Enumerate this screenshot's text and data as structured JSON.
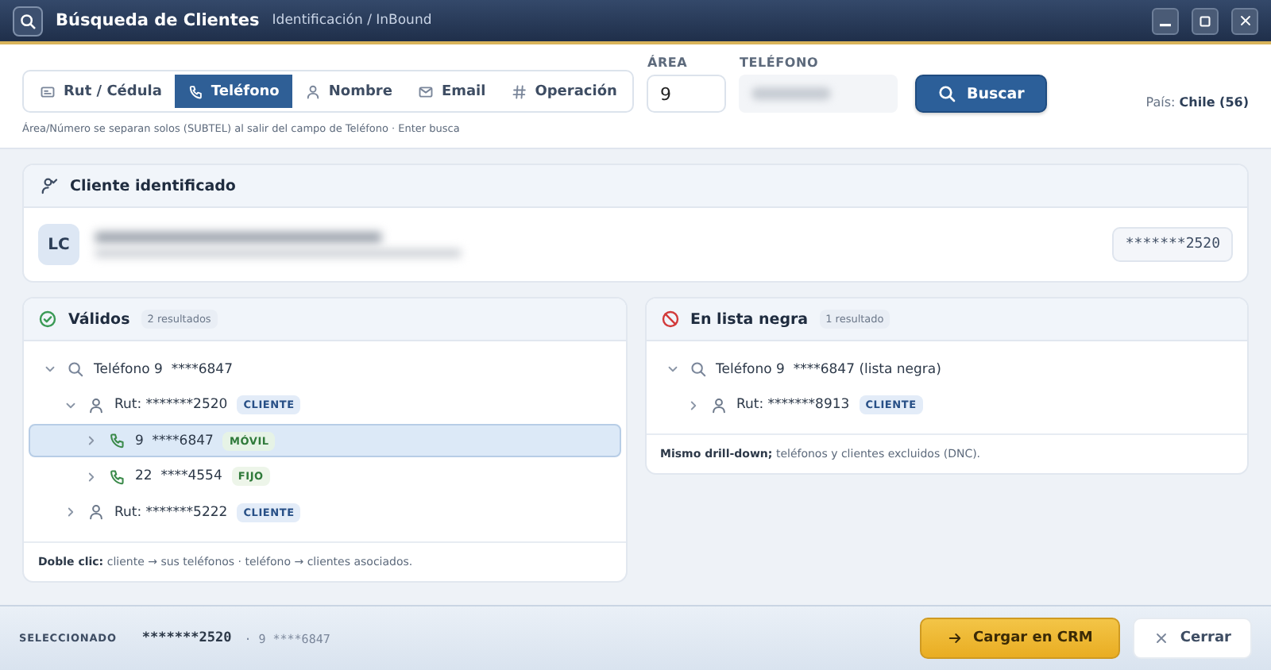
{
  "window": {
    "title": "Búsqueda de Clientes",
    "subtitle": "Identificación / InBound"
  },
  "search": {
    "tabs": [
      {
        "label": "Rut / Cédula",
        "kind": "id",
        "selected": false
      },
      {
        "label": "Teléfono",
        "kind": "phone",
        "selected": true
      },
      {
        "label": "Nombre",
        "kind": "person",
        "selected": false
      },
      {
        "label": "Email",
        "kind": "mail",
        "selected": false
      },
      {
        "label": "Operación",
        "kind": "hash",
        "selected": false
      }
    ],
    "hint": "Área/Número se separan solos (SUBTEL) al salir del campo de Teléfono · Enter busca",
    "area": {
      "label": "ÁREA",
      "value": "9"
    },
    "phone": {
      "label": "TELÉFONO",
      "redacted": true
    },
    "button": "Buscar",
    "country_label": "País:",
    "country": "Chile (56)"
  },
  "client": {
    "title": "Cliente identificado",
    "initials": "LC",
    "name_redacted": true,
    "rut": "*******2520"
  },
  "panels": [
    {
      "kind": "valid",
      "title": "Válidos",
      "count": "2 resultados",
      "footer": "**Doble clic:** cliente → sus teléfonos · teléfono → clientes asociados.",
      "tree": [
        {
          "kind": "search",
          "label": "Teléfono 9  ****6847",
          "expanded": true,
          "selected": false,
          "children": [
            {
              "kind": "client",
              "label": "Rut: *******2520",
              "tag": "CLIENTE",
              "expanded": true,
              "selected": false,
              "children": [
                {
                  "kind": "phone",
                  "label": "9  ****6847",
                  "tag": "MÓVIL",
                  "expanded": false,
                  "selected": true
                },
                {
                  "kind": "phone",
                  "label": "22  ****4554",
                  "tag": "FIJO",
                  "expanded": false,
                  "selected": false
                }
              ]
            },
            {
              "kind": "client",
              "label": "Rut: *******5222",
              "tag": "CLIENTE",
              "expanded": false,
              "selected": false
            }
          ]
        }
      ]
    },
    {
      "kind": "blacklist",
      "title": "En lista negra",
      "count": "1 resultado",
      "footer": "**Mismo drill-down;** teléfonos y clientes excluidos (DNC).",
      "tree": [
        {
          "kind": "search",
          "label": "Teléfono 9  ****6847 (lista negra)",
          "expanded": true,
          "selected": false,
          "children": [
            {
              "kind": "client",
              "label": "Rut: *******8913",
              "tag": "CLIENTE",
              "expanded": false,
              "selected": false
            }
          ]
        }
      ]
    }
  ],
  "status": {
    "label": "SELECCIONADO",
    "rut": "*******2520",
    "detail": "· 9 ****6847"
  },
  "buttons": [
    {
      "kind": "primary",
      "label": "Cargar en CRM"
    },
    {
      "kind": "secondary",
      "label": "Cerrar"
    }
  ]
}
